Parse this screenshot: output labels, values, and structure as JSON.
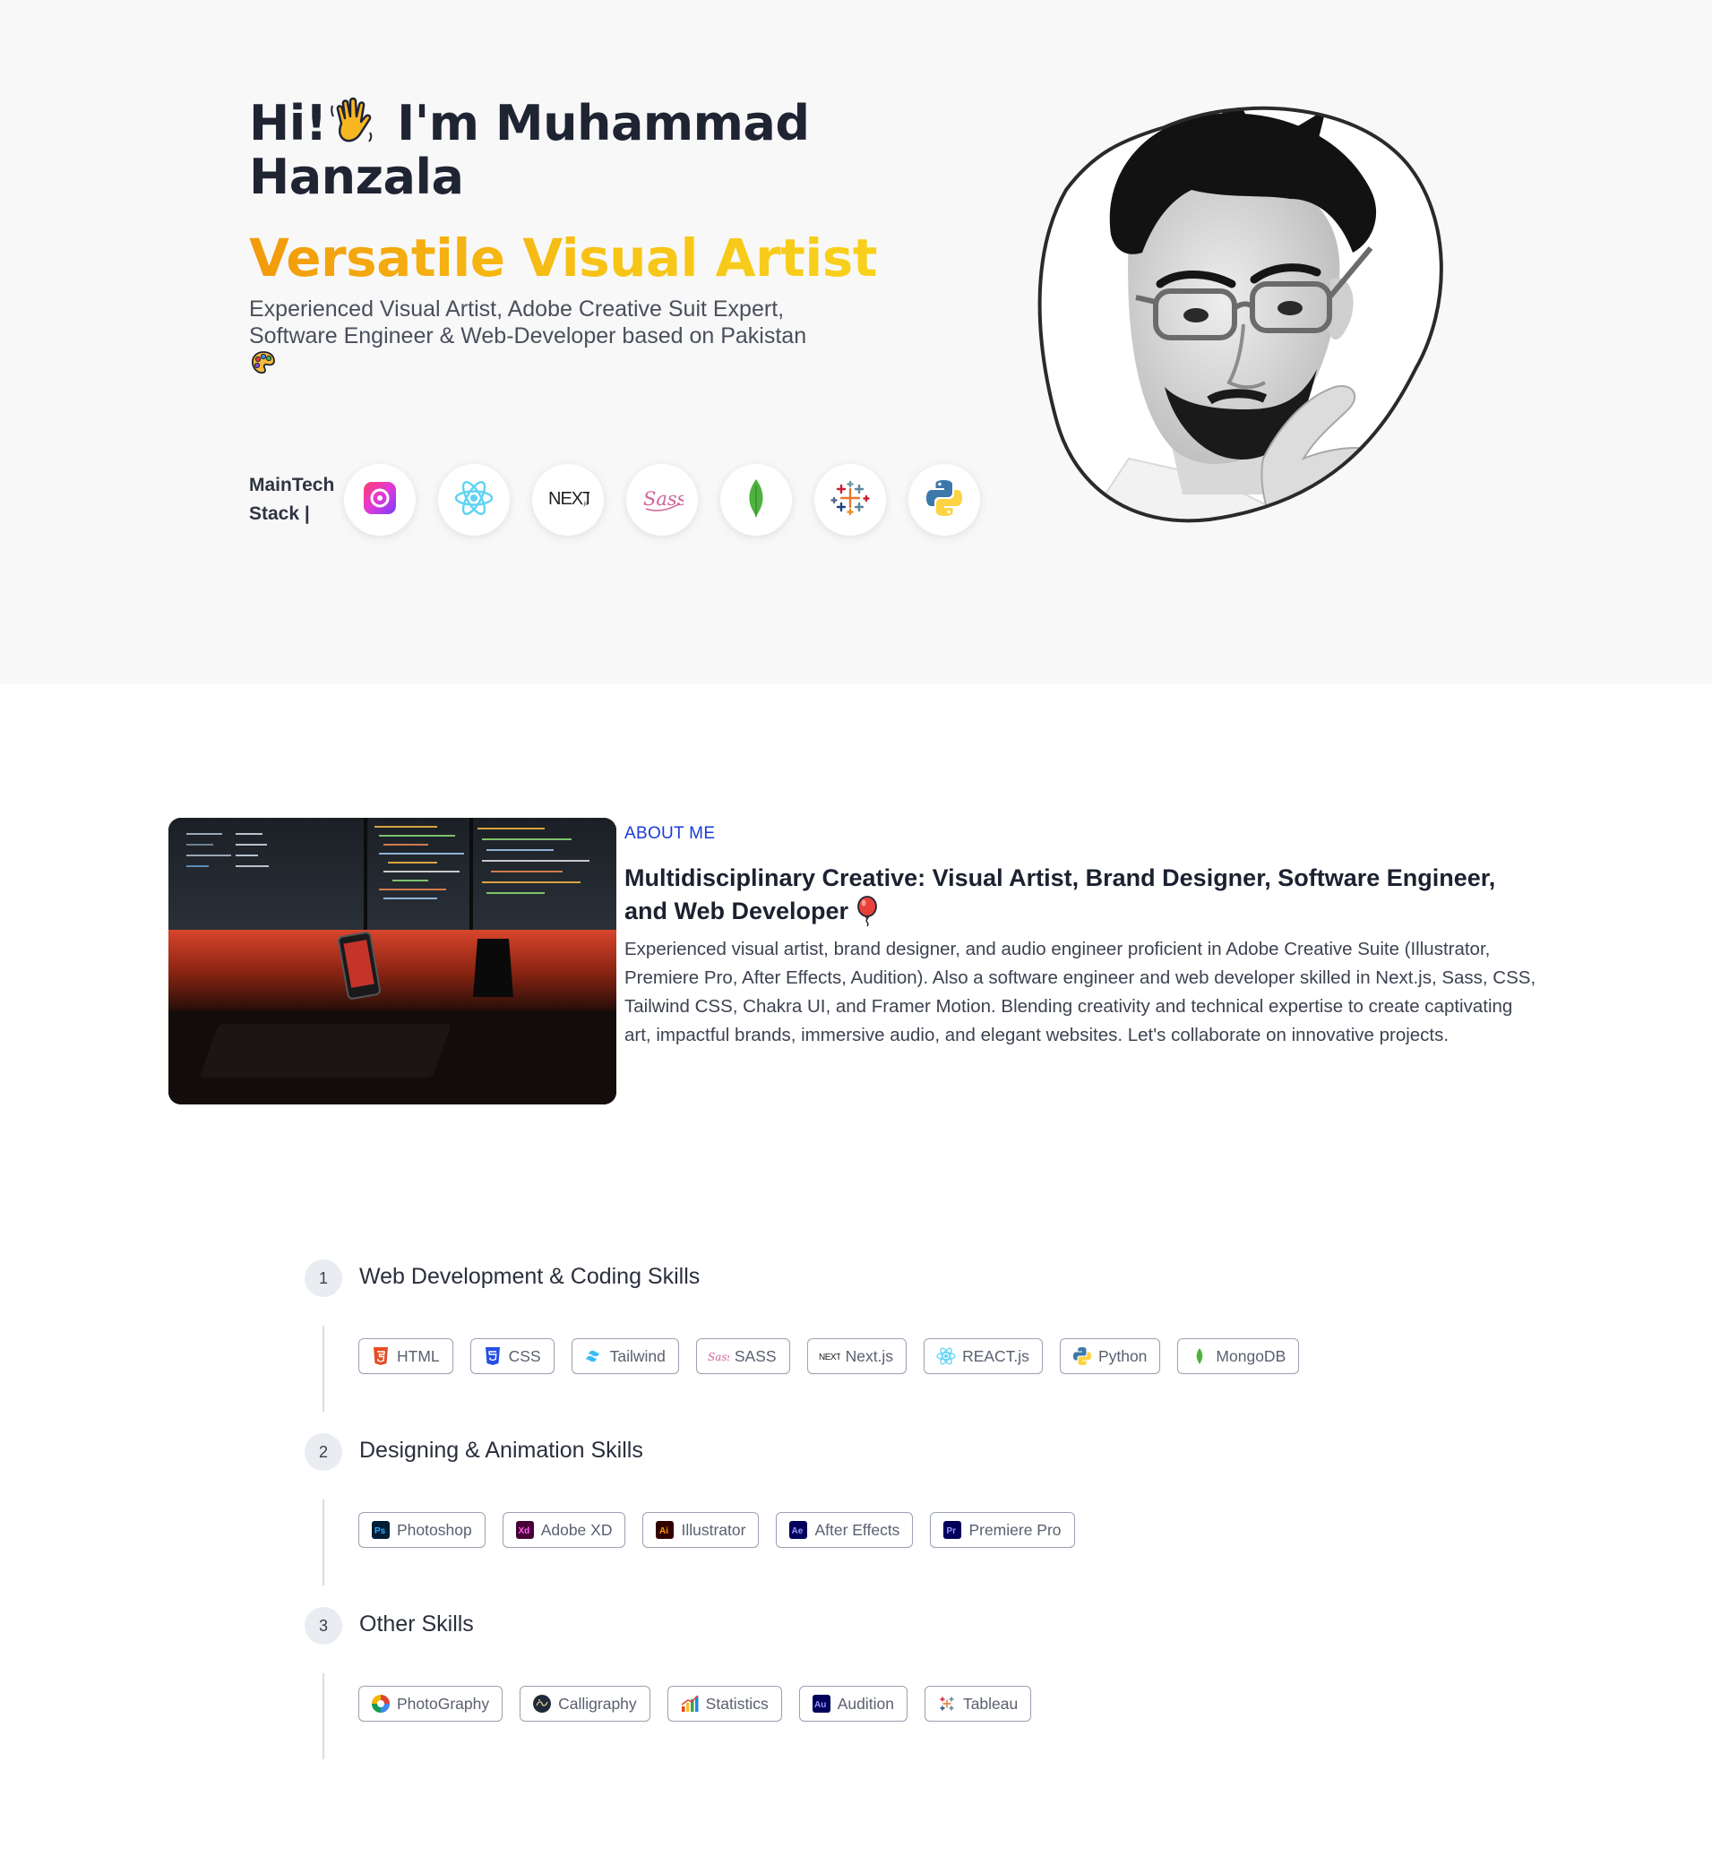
{
  "hero": {
    "greeting_prefix": "Hi!",
    "greeting_name": " I'm Muhammad Hanzala",
    "role": "Versatile Visual Artist",
    "description": "Experienced Visual Artist, Adobe Creative Suit Expert, Software Engineer & Web-Developer based on Pakistan",
    "stack_label_line1": "MainTech",
    "stack_label_line2": "Stack |",
    "stack_icons": [
      "creative-cloud-icon",
      "react-icon",
      "nextjs-icon",
      "sass-icon",
      "mongodb-icon",
      "tableau-icon",
      "python-icon"
    ]
  },
  "about": {
    "tag": "ABOUT ME",
    "title": "Multidisciplinary Creative: Visual Artist, Brand Designer, Software Engineer, and Web Developer",
    "body": "Experienced visual artist, brand designer, and audio engineer proficient in Adobe Creative Suite (Illustrator, Premiere Pro, After Effects, Audition). Also a software engineer and web developer skilled in Next.js, Sass, CSS, Tailwind CSS, Chakra UI, and Framer Motion. Blending creativity and technical expertise to create captivating art, impactful brands, immersive audio, and elegant websites. Let's collaborate on innovative projects."
  },
  "skills": [
    {
      "number": "1",
      "title": "Web Development & Coding Skills",
      "items": [
        "HTML",
        "CSS",
        "Tailwind",
        "SASS",
        "Next.js",
        "REACT.js",
        "Python",
        "MongoDB"
      ]
    },
    {
      "number": "2",
      "title": "Designing & Animation Skills",
      "items": [
        "Photoshop",
        "Adobe XD",
        "Illustrator",
        "After Effects",
        "Premiere Pro"
      ]
    },
    {
      "number": "3",
      "title": "Other Skills",
      "items": [
        "PhotoGraphy",
        "Calligraphy",
        "Statistics",
        "Audition",
        "Tableau"
      ]
    }
  ],
  "colors": {
    "hero_bg": "#f8f8f8",
    "accent_gradient_start": "#f29a0b",
    "accent_gradient_end": "#f8d21c",
    "about_tag": "#1a3bd6",
    "chip_border": "#9aa3b3"
  }
}
